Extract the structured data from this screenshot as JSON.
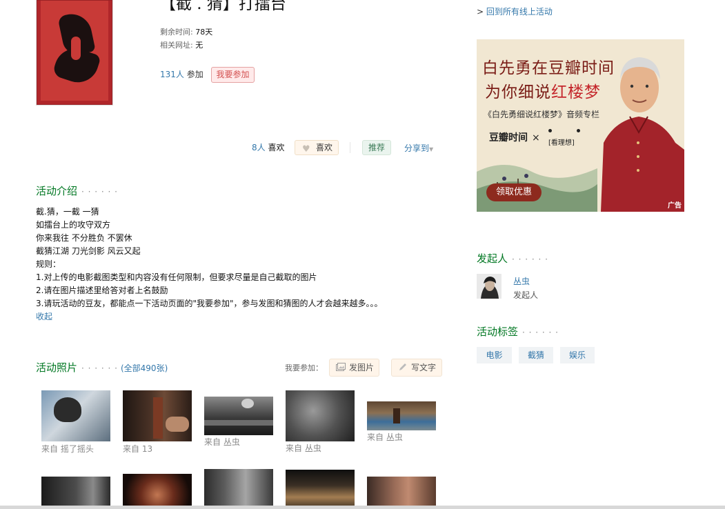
{
  "event": {
    "title": "【截 . 猜】打擂台",
    "meta": {
      "remaining_label": "剩余时间:",
      "remaining_value": "78天",
      "url_label": "相关网址:",
      "url_value": "无"
    },
    "joined_count": "131人",
    "joined_suffix": "参加",
    "join_button": "我要参加",
    "likes_count": "8人",
    "likes_suffix": "喜欢",
    "like_button": "喜欢",
    "recommend_button": "推荐",
    "share_label": "分享到"
  },
  "intro": {
    "heading": "活动介绍",
    "dots": "· · · · · ·",
    "lines": [
      "截.猜，一截 一猜",
      "如擂台上的攻守双方",
      "你来我往 不分胜负 不罢休",
      "截猜江湖 刀光剑影 风云又起",
      "规则：",
      "1.对上传的电影截图类型和内容没有任何限制，但要求尽量是自己截取的图片",
      "2.请在图片描述里给答对者上名鼓励",
      "3.请玩活动的豆友，都能点一下活动页面的\"我要参加\"，参与发图和猜图的人才会越来越多。。。"
    ],
    "collapse": "收起"
  },
  "photos": {
    "heading": "活动照片",
    "dots": "· · · · · ·",
    "count_link": "(全部490张)",
    "want_label": "我要参加：",
    "upload_photo": "发图片",
    "write_text": "写文字",
    "row1": [
      {
        "prefix": "来自",
        "author": "摇了摇头"
      },
      {
        "prefix": "来自",
        "author": "13"
      },
      {
        "prefix": "来自",
        "author": "丛虫"
      },
      {
        "prefix": "来自",
        "author": "丛虫"
      },
      {
        "prefix": "来自",
        "author": "丛虫"
      }
    ]
  },
  "sidebar": {
    "back_link": "回到所有线上活动",
    "ad": {
      "line1": "白先勇在豆瓣时间",
      "line2_pre": "为你细说",
      "line2_hl": "红楼梦",
      "line3": "《白先勇细说红楼梦》音频专栏",
      "brand": "豆瓣时间",
      "times": "×",
      "partner": "[看理想]",
      "cta": "领取优惠",
      "tag": "广告"
    },
    "initiator": {
      "heading": "发起人",
      "dots": "· · · · · ·",
      "name": "丛虫",
      "role": "发起人"
    },
    "tags": {
      "heading": "活动标签",
      "dots": "· · · · · ·",
      "items": [
        "电影",
        "截猜",
        "娱乐"
      ]
    }
  },
  "colors": {
    "link": "#3377aa",
    "section_heading": "#007722",
    "join_button_text": "#d35050"
  }
}
